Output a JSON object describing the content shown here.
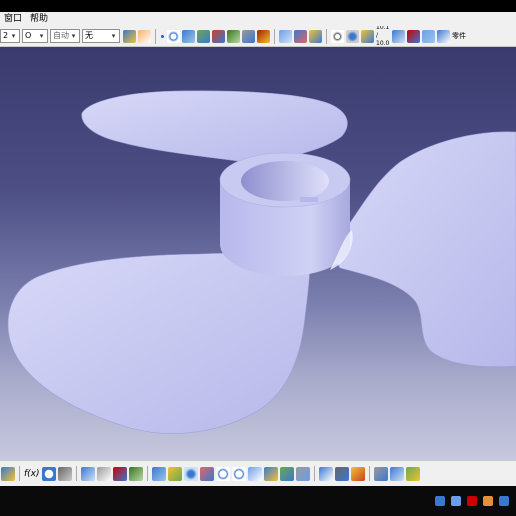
{
  "menu": {
    "items": [
      "窗口",
      "帮助"
    ]
  },
  "toolbar": {
    "combo1_value": "2",
    "combo2_value": "O",
    "combo3_value": "自动",
    "combo4_value": "无",
    "text_icon_label": "10.1 / 10.0",
    "last_label": "零件"
  },
  "colors": {
    "viewport_top": "#3a3a6e",
    "viewport_bottom": "#c7c8de",
    "part_fill": "#c5c6ef",
    "part_shadow": "#9d9ed6",
    "toolbar_bg": "#f0f0f0"
  },
  "bottom_toolbar": {
    "formula_label": "f(x)"
  }
}
